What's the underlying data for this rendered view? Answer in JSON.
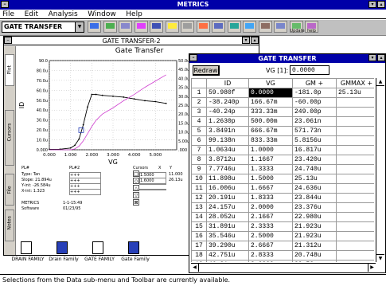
{
  "app": {
    "title": "METRICS"
  },
  "menu": [
    "File",
    "Edit",
    "Analysis",
    "Window",
    "Help"
  ],
  "toolbar": {
    "combo_value": "GATE TRANSFER",
    "tools": [
      "tool",
      "tool",
      "tool",
      "tool",
      "tool",
      "tool",
      "tool",
      "tool",
      "tool",
      "tool",
      "tool",
      "tool",
      "tool",
      "tool",
      "tool"
    ],
    "tool_labels": [
      "",
      "",
      "",
      "",
      "",
      "",
      "",
      "",
      "",
      "",
      "",
      "",
      "",
      "Update",
      "help"
    ]
  },
  "chart_window": {
    "title": "GATE TRANSFER-2",
    "chart_title": "Gate Transfer",
    "side_tabs": [
      "Plot",
      "Cursors",
      "File",
      "Notes"
    ]
  },
  "chart_data": {
    "type": "line",
    "title": "Gate Transfer",
    "xlabel": "VG",
    "ylabel": "ID",
    "xlim": [
      0,
      6
    ],
    "ylim": [
      0,
      100
    ],
    "x_ticks": [
      "0.000",
      "1.000",
      "2.000",
      "3.000",
      "4.000",
      "5.000"
    ],
    "y_ticks": [
      "90.0",
      "80.0u",
      "70.0u",
      "60.0u",
      "50.0u",
      "40.0u",
      "30.0u",
      "20.0u",
      "10.0u",
      "0.000"
    ],
    "y2_ticks": [
      "50.0u",
      "45.0u",
      "40.0u",
      "35.0u",
      "30.0u",
      "25.0u",
      "20.0u",
      "15.0u",
      "10.0u",
      "5.00u",
      ".000"
    ],
    "series": [
      {
        "x": [
          0,
          0.5,
          1.0,
          1.2,
          1.4,
          1.6,
          1.8,
          2.0,
          2.2,
          2.5,
          3.0,
          3.5,
          4.0,
          4.5,
          5.0,
          5.5
        ],
        "values": [
          0.5,
          0.6,
          2,
          5,
          12,
          28,
          48,
          62,
          62,
          61,
          60,
          59,
          57,
          55,
          54,
          52
        ]
      },
      {
        "x": [
          0,
          0.5,
          1.0,
          1.2,
          1.4,
          1.6,
          1.8,
          2.0,
          2.2,
          2.5,
          3.0,
          3.5,
          4.0,
          4.5,
          5.0,
          5.5
        ],
        "values": [
          0,
          0,
          0,
          1,
          4,
          10,
          18,
          26,
          33,
          40,
          47,
          55,
          62,
          70,
          77,
          84
        ]
      }
    ]
  },
  "info_panel": {
    "headers": [
      "PL#",
      "PL#2",
      "Cursors",
      "X",
      "Y"
    ],
    "rows": [
      [
        "Type: Tan",
        "+++",
        "1.5000",
        "11.000"
      ],
      [
        "Slope: 21.894u",
        "+++",
        "1.6000",
        "26.13u"
      ],
      [
        "Y-int: -26.584u",
        "+++",
        "",
        ""
      ],
      [
        "X-int: 1.323",
        "+++",
        "",
        ""
      ]
    ],
    "footer": [
      [
        "METRICS",
        "1-1-15:49"
      ],
      [
        "Software",
        "01/23/95"
      ]
    ]
  },
  "table_window": {
    "title": "GATE TRANSFER",
    "redraw": "Redraw",
    "cell_ref": "VG [1]:",
    "cell_value": "0.0000",
    "columns": [
      "ID",
      "VG",
      "GM +",
      "GMMAX +"
    ],
    "rows": [
      [
        "1",
        "59.980f",
        "0.0000",
        "-181.0p",
        "25.13u"
      ],
      [
        "2",
        "-38.240p",
        "166.67m",
        "-60.00p",
        ""
      ],
      [
        "3",
        "-40.24p",
        "333.33m",
        "249.00p",
        ""
      ],
      [
        "4",
        "1.2630p",
        "500.00m",
        "23.061n",
        ""
      ],
      [
        "5",
        "3.8491n",
        "666.67m",
        "571.73n",
        ""
      ],
      [
        "6",
        "99.138n",
        "833.33m",
        "5.8156u",
        ""
      ],
      [
        "7",
        "1.0634u",
        "1.0000",
        "16.817u",
        ""
      ],
      [
        "8",
        "3.8712u",
        "1.1667",
        "23.420u",
        ""
      ],
      [
        "9",
        "7.7746u",
        "1.3333",
        "24.740u",
        ""
      ],
      [
        "10",
        "11.898u",
        "1.5000",
        "25.13u",
        ""
      ],
      [
        "11",
        "16.006u",
        "1.6667",
        "24.636u",
        ""
      ],
      [
        "12",
        "20.191u",
        "1.8333",
        "23.844u",
        ""
      ],
      [
        "13",
        "24.157u",
        "2.0000",
        "23.376u",
        ""
      ],
      [
        "14",
        "28.052u",
        "2.1667",
        "22.980u",
        ""
      ],
      [
        "15",
        "31.891u",
        "2.3333",
        "21.923u",
        ""
      ],
      [
        "16",
        "35.546u",
        "2.5000",
        "21.923u",
        ""
      ],
      [
        "17",
        "39.290u",
        "2.6667",
        "21.312u",
        ""
      ],
      [
        "18",
        "42.751u",
        "2.8333",
        "20.748u",
        ""
      ],
      [
        "19",
        "46.21u",
        "3.0000",
        "20.52u",
        ""
      ]
    ]
  },
  "desktop_icons": [
    "DRAIN FAMILY",
    "Drain Family",
    "GATE FAMILY",
    "Gate Family"
  ],
  "status": "Selections from the Data sub-menu and Toolbar are currently available."
}
